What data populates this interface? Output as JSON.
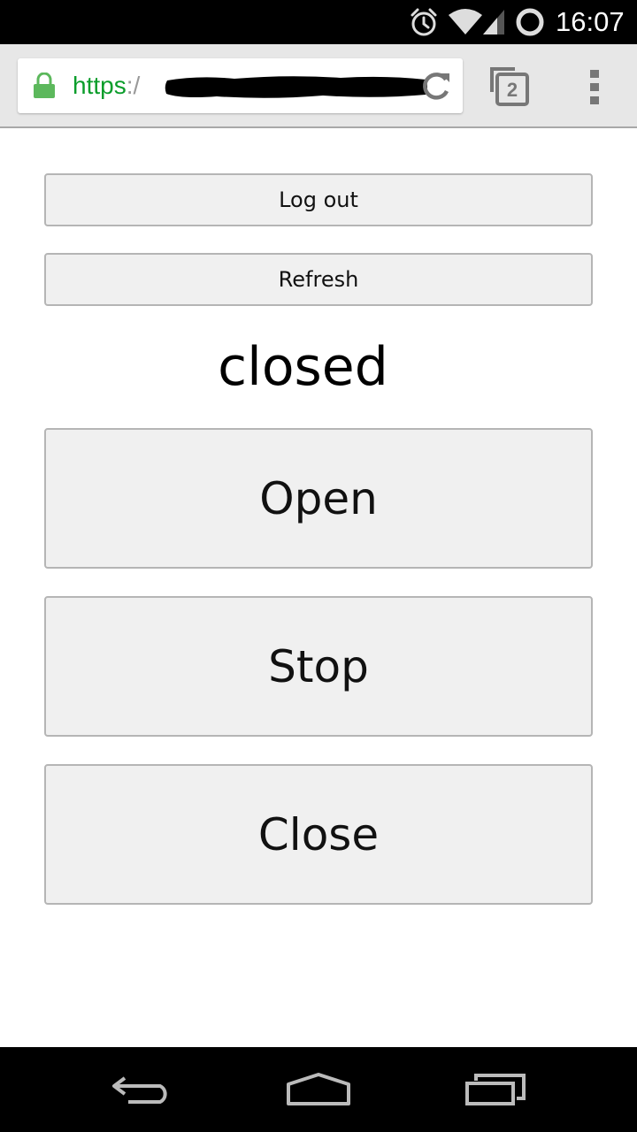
{
  "status_bar": {
    "time": "16:07",
    "icons": [
      "alarm-icon",
      "wifi-icon",
      "cell-signal-icon",
      "sync-icon"
    ]
  },
  "browser": {
    "url_scheme": "https",
    "url_separator": ":/",
    "tab_count": "2",
    "icons": [
      "lock-icon",
      "reload-icon",
      "tab-switcher-icon",
      "overflow-menu-icon"
    ],
    "url_color": "#0b9d2b"
  },
  "page": {
    "logout_label": "Log out",
    "refresh_label": "Refresh",
    "status_text": "closed",
    "open_label": "Open",
    "stop_label": "Stop",
    "close_label": "Close"
  },
  "nav_bar": {
    "icons": [
      "back-icon",
      "home-icon",
      "recents-icon"
    ]
  }
}
